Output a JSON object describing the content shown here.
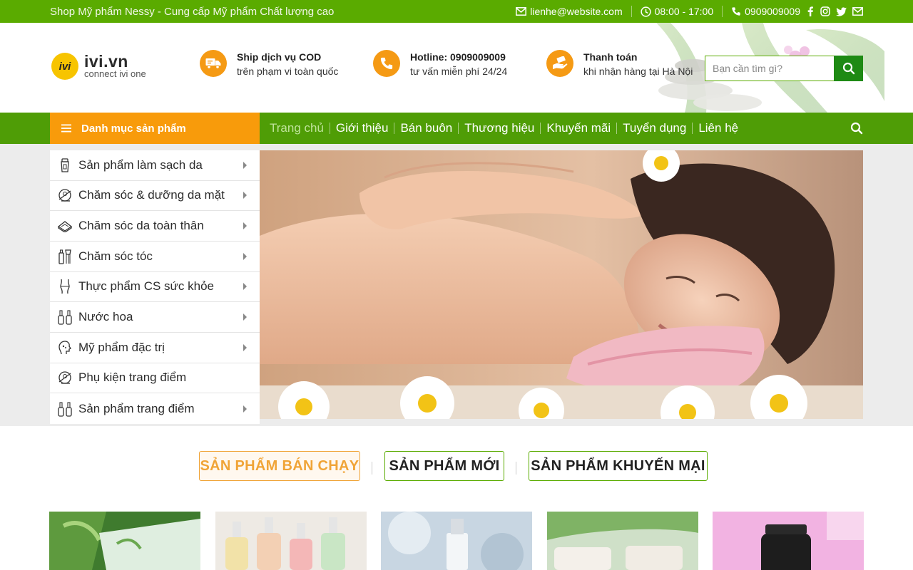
{
  "topbar": {
    "tagline": "Shop Mỹ phẩm Nessy - Cung cấp Mỹ phẩm Chất lượng cao",
    "email": "lienhe@website.com",
    "hours": "08:00 - 17:00",
    "phone": "0909009009",
    "social": [
      "facebook-icon",
      "instagram-icon",
      "twitter-icon",
      "envelope-icon"
    ]
  },
  "header": {
    "logo": {
      "mark": "ivi",
      "name": "ivi.vn",
      "subtitle": "connect ivi one"
    },
    "features": [
      {
        "icon": "delivery-truck-icon",
        "title": "Ship dịch vụ COD",
        "subtitle": "trên phạm vi toàn quốc"
      },
      {
        "icon": "phone-icon",
        "title": "Hotline: 0909009009",
        "subtitle": "tư vấn miễn phí 24/24"
      },
      {
        "icon": "payment-hand-icon",
        "title": "Thanh toán",
        "subtitle": "khi nhận hàng tại Hà Nội"
      }
    ],
    "search": {
      "placeholder": "Bạn cần tìm gì?",
      "value": ""
    }
  },
  "nav": {
    "category_label": "Danh mục sản phẩm",
    "menu": [
      {
        "label": "Trang chủ",
        "active": true
      },
      {
        "label": "Giới thiệu",
        "active": false
      },
      {
        "label": "Bán buôn",
        "active": false
      },
      {
        "label": "Thương hiệu",
        "active": false
      },
      {
        "label": "Khuyến mãi",
        "active": false
      },
      {
        "label": "Tuyển dụng",
        "active": false
      },
      {
        "label": "Liên hệ",
        "active": false
      }
    ]
  },
  "sidebar": {
    "items": [
      {
        "label": "Sản phẩm làm sạch da",
        "icon": "cleanser-tube-icon",
        "has_submenu": true
      },
      {
        "label": "Chăm sóc & dưỡng da mặt",
        "icon": "face-care-icon",
        "has_submenu": true
      },
      {
        "label": "Chăm sóc da toàn thân",
        "icon": "soap-bar-icon",
        "has_submenu": true
      },
      {
        "label": "Chăm sóc tóc",
        "icon": "hair-care-icon",
        "has_submenu": true
      },
      {
        "label": "Thực phẩm CS sức khỏe",
        "icon": "body-shape-icon",
        "has_submenu": true
      },
      {
        "label": "Nước hoa",
        "icon": "perfume-bottles-icon",
        "has_submenu": true
      },
      {
        "label": "Mỹ phẩm đặc trị",
        "icon": "treatment-face-icon",
        "has_submenu": true
      },
      {
        "label": "Phụ kiện trang điểm",
        "icon": "makeup-mirror-icon",
        "has_submenu": false
      },
      {
        "label": "Sản phẩm trang điểm",
        "icon": "nail-polish-icon",
        "has_submenu": true
      }
    ]
  },
  "tabs": [
    {
      "label": "SẢN PHẨM BÁN CHẠY",
      "active": true
    },
    {
      "label": "SẢN PHẨM MỚI",
      "active": false
    },
    {
      "label": "SẢN PHẨM KHUYẾN MẠI",
      "active": false
    }
  ],
  "products": [
    {
      "image": "innisfree-green-tea-kit-image"
    },
    {
      "image": "pump-bottles-image"
    },
    {
      "image": "serum-bottle-image"
    },
    {
      "image": "cream-jars-image"
    },
    {
      "image": "dropper-bottle-image"
    }
  ],
  "colors": {
    "topbar": "#5aab00",
    "nav": "#4f9d06",
    "category_button": "#f89b0b",
    "feature_icon": "#f59a14",
    "search_button": "#1e8a14",
    "active_tab": "#f0a437"
  }
}
